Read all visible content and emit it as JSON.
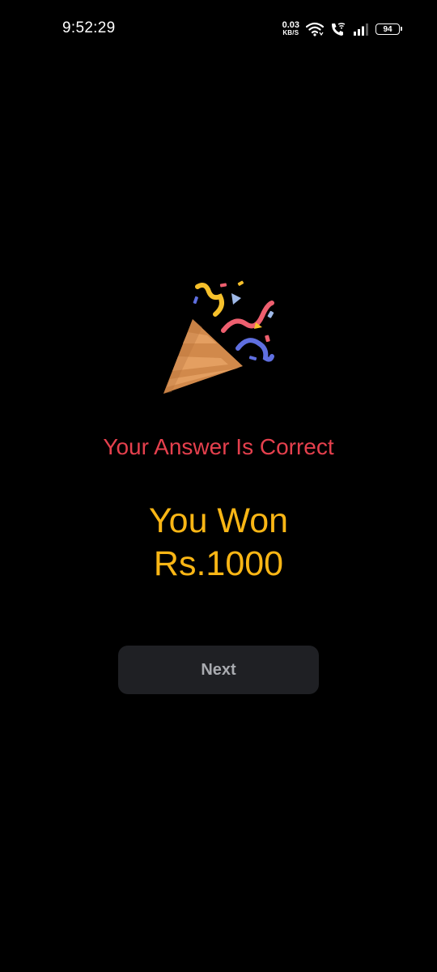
{
  "status_bar": {
    "time": "9:52:29",
    "net_speed_value": "0.03",
    "net_speed_unit": "KB/S",
    "battery_level": "94",
    "icons": [
      "wifi-icon",
      "wifi-call-icon",
      "signal-icon",
      "battery-icon"
    ]
  },
  "celebration": {
    "icon": "party-popper-icon"
  },
  "result": {
    "message": "Your Answer Is Correct",
    "win_line_1": "You Won",
    "win_line_2": "Rs.1000"
  },
  "actions": {
    "next_label": "Next"
  },
  "colors": {
    "background": "#000000",
    "message": "#e5404d",
    "prize": "#fab615",
    "button_bg": "#1f2024",
    "button_text": "#a9abb0"
  }
}
